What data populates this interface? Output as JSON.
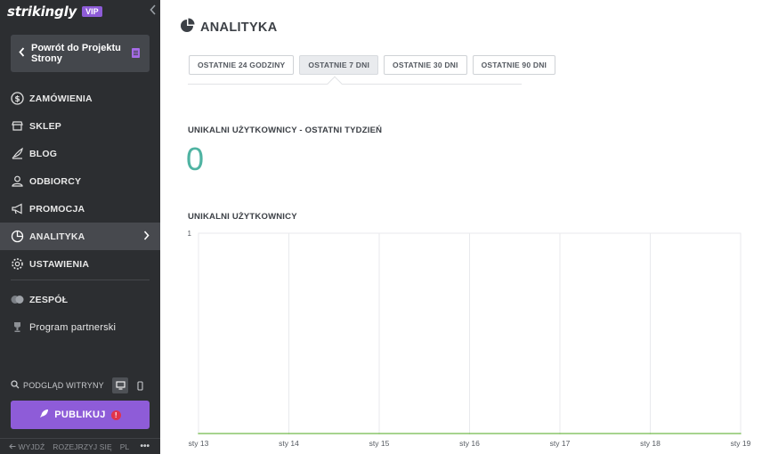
{
  "sidebar": {
    "brand": "strikingly",
    "badge": "VIP",
    "back_button": "Powrót do Projektu Strony",
    "items": [
      {
        "label": "ZAMÓWIENIA",
        "icon": "dollar-icon"
      },
      {
        "label": "SKLEP",
        "icon": "store-icon"
      },
      {
        "label": "BLOG",
        "icon": "quill-icon"
      },
      {
        "label": "ODBIORCY",
        "icon": "users-icon"
      },
      {
        "label": "PROMOCJA",
        "icon": "megaphone-icon"
      },
      {
        "label": "ANALITYKA",
        "icon": "pie-chart-icon",
        "active": true
      },
      {
        "label": "USTAWIENIA",
        "icon": "gear-icon"
      },
      {
        "label": "ZESPÓŁ",
        "icon": "team-icon"
      },
      {
        "label": "Program partnerski",
        "icon": "trophy-icon"
      }
    ],
    "preview_label": "PODGLĄD WITRYNY",
    "publish_label": "PUBLIKUJ",
    "publish_alert": "!",
    "footer": {
      "exit": "WYJDŹ",
      "register": "ROZEJRZYJ SIĘ",
      "lang": "PL",
      "more": "•••"
    }
  },
  "main": {
    "title": "ANALITYKA",
    "tabs": [
      {
        "label": "OSTATNIE 24 GODZINY",
        "active": false
      },
      {
        "label": "OSTATNIE 7 DNI",
        "active": true
      },
      {
        "label": "OSTATNIE 30 DNI",
        "active": false
      },
      {
        "label": "OSTATNIE 90 DNI",
        "active": false
      }
    ],
    "stat_label": "UNIKALNI UŻYTKOWNICY - OSTATNI TYDZIEŃ",
    "stat_value": "0",
    "chart_title": "UNIKALNI UŻYTKOWNICY"
  },
  "colors": {
    "accent": "#8e5cd8",
    "stat": "#4fb3a2",
    "line": "#8ac56a",
    "sidebar_bg": "#2c2e31"
  },
  "chart_data": {
    "type": "line",
    "categories": [
      "sty 13",
      "sty 14",
      "sty 15",
      "sty 16",
      "sty 17",
      "sty 18",
      "sty 19"
    ],
    "series": [
      {
        "values": [
          0,
          0,
          0,
          0,
          0,
          0,
          0
        ]
      }
    ],
    "ylim": [
      0,
      1
    ],
    "y_ticks": [
      "1"
    ],
    "grid": true
  }
}
